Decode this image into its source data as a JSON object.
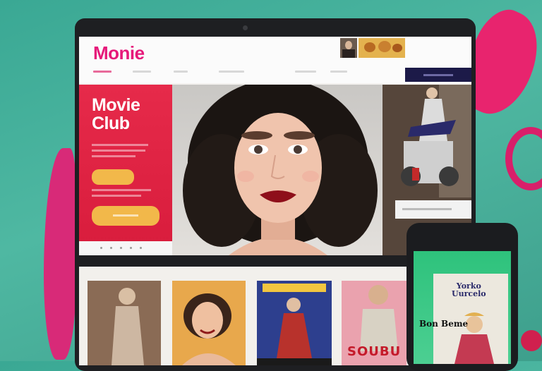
{
  "app": {
    "logo": "Monie"
  },
  "hero": {
    "title_line1": "Movie",
    "title_line2": "Club"
  },
  "posters": [
    {
      "label": ""
    },
    {
      "label": ""
    },
    {
      "label": ""
    },
    {
      "label": "SOUBU"
    }
  ],
  "phone": {
    "title": "Bon Beme",
    "poster_title_line1": "Yorko",
    "poster_title_line2": "Uurcelo"
  },
  "colors": {
    "brand_pink": "#e6197a",
    "hero_red": "#e62a4a",
    "button_yellow": "#f2b84a",
    "nav_navy": "#1c1a48",
    "background_teal": "#3aa894",
    "phone_green": "#2ec27c"
  }
}
